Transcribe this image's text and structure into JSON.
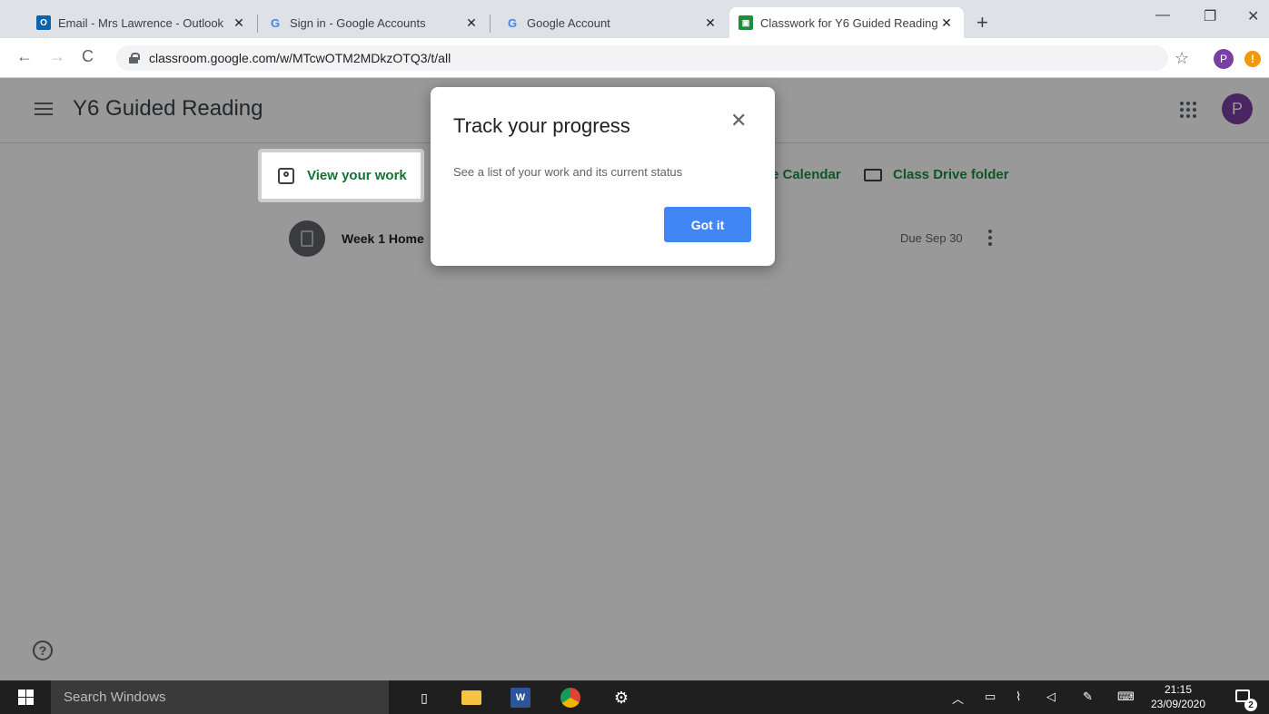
{
  "browser": {
    "tabs": [
      {
        "label": "Email - Mrs Lawrence - Outlook",
        "icon": "outlook-icon",
        "close": "✕"
      },
      {
        "label": "Sign in - Google Accounts",
        "icon": "google-icon",
        "close": "✕"
      },
      {
        "label": "Google Account",
        "icon": "google-icon",
        "close": "✕"
      },
      {
        "label": "Classwork for Y6 Guided Reading",
        "icon": "classroom-icon",
        "close": "✕",
        "active": true
      }
    ],
    "new_tab": "+",
    "window_controls": {
      "minimize": "—",
      "restore": "❐",
      "close": "✕"
    },
    "url": "classroom.google.com/w/MTcwOTM2MDkzOTQ3/t/all",
    "profile_initial": "P",
    "update_glyph": "!"
  },
  "classroom": {
    "class_title": "Y6 Guided Reading",
    "profile_initial": "P",
    "links": {
      "view_work": "View your work",
      "calendar_partial": "e Calendar",
      "drive": "Class Drive folder"
    },
    "assignment": {
      "title_partial": "Week 1 Home",
      "due": "Due Sep 30"
    },
    "help_glyph": "?"
  },
  "dialog": {
    "title": "Track your progress",
    "close_glyph": "✕",
    "text": "See a list of your work and its current status",
    "button": "Got it"
  },
  "taskbar": {
    "search_placeholder": "Search Windows",
    "time": "21:15",
    "date": "23/09/2020",
    "notification_count": "2"
  },
  "colors": {
    "accent_blue": "#4285f4",
    "classroom_green": "#137333",
    "profile_purple": "#7b3fa3",
    "update_orange": "#f29900"
  }
}
